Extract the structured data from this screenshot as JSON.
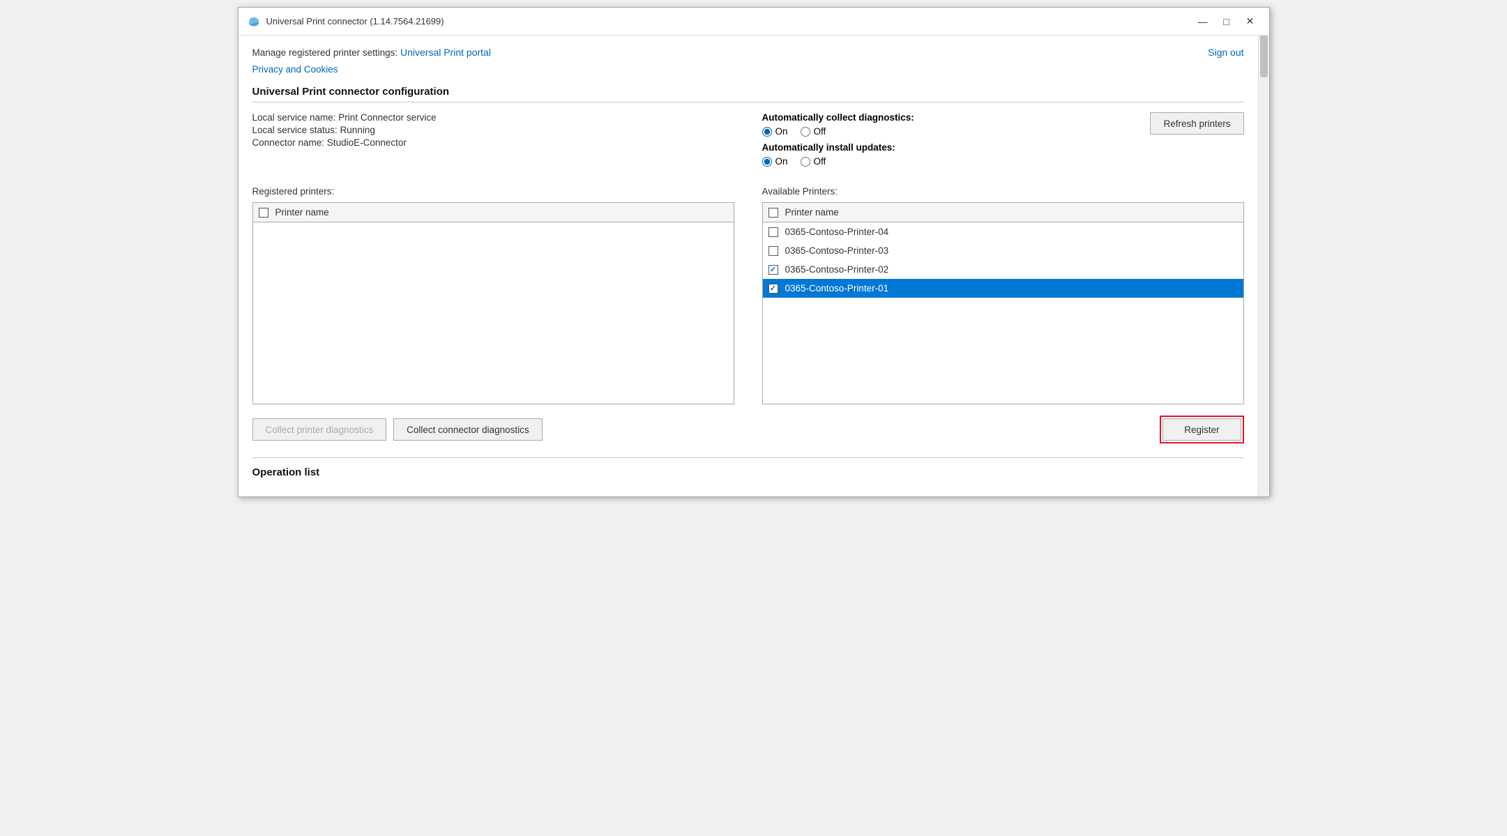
{
  "window": {
    "title": "Universal Print connector (1.14.7564.21699)",
    "controls": {
      "minimize": "—",
      "maximize": "□",
      "close": "✕"
    }
  },
  "header": {
    "manage_text": "Manage registered printer settings:",
    "portal_link": "Universal Print portal",
    "sign_out": "Sign out",
    "privacy_link": "Privacy and Cookies"
  },
  "config_section": {
    "title": "Universal Print connector configuration",
    "service_name": "Local service name: Print Connector service",
    "service_status": "Local service status: Running",
    "connector_name": "Connector name: StudioE-Connector",
    "diagnostics": {
      "label": "Automatically collect diagnostics:",
      "on_label": "On",
      "off_label": "Off",
      "selected": "on"
    },
    "updates": {
      "label": "Automatically install updates:",
      "on_label": "On",
      "off_label": "Off",
      "selected": "on"
    },
    "refresh_btn": "Refresh printers"
  },
  "registered_printers": {
    "label": "Registered printers:",
    "header": "Printer name",
    "rows": []
  },
  "available_printers": {
    "label": "Available Printers:",
    "header": "Printer name",
    "rows": [
      {
        "name": "0365-Contoso-Printer-04",
        "checked": false,
        "selected": false
      },
      {
        "name": "0365-Contoso-Printer-03",
        "checked": false,
        "selected": false
      },
      {
        "name": "0365-Contoso-Printer-02",
        "checked": true,
        "selected": false
      },
      {
        "name": "0365-Contoso-Printer-01",
        "checked": true,
        "selected": true
      }
    ]
  },
  "buttons": {
    "collect_printer": "Collect printer diagnostics",
    "collect_connector": "Collect connector diagnostics",
    "register": "Register"
  },
  "operation_section": {
    "title": "Operation list"
  }
}
